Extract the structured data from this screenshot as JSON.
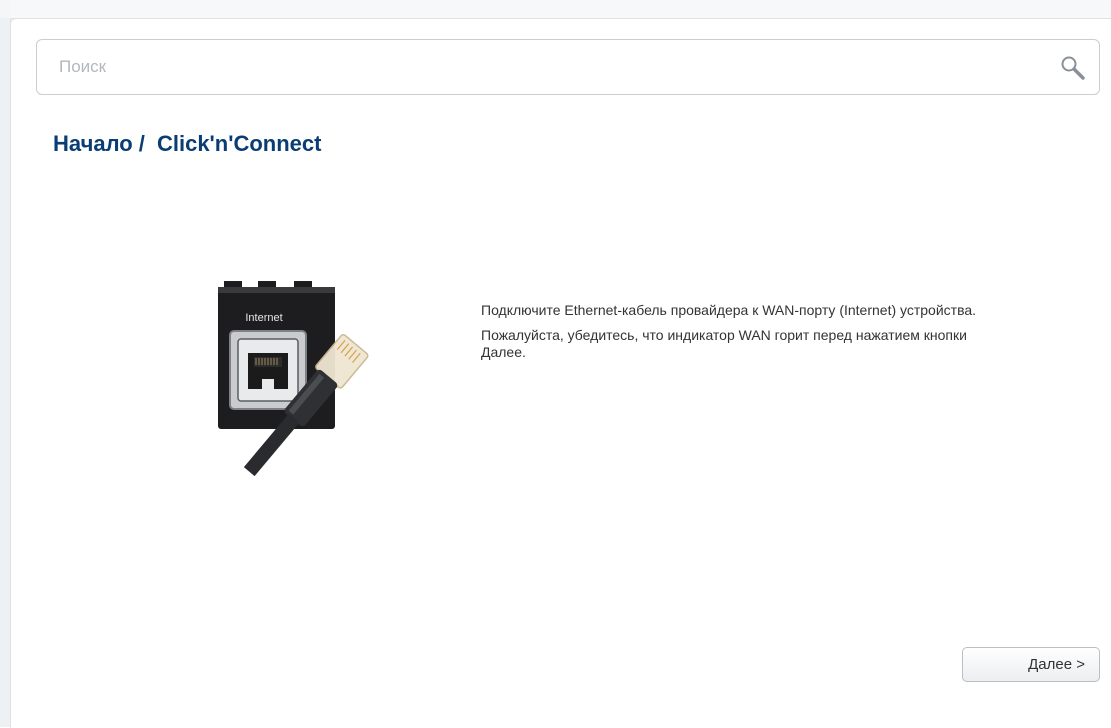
{
  "search": {
    "placeholder": "Поиск"
  },
  "breadcrumb": {
    "home": "Начало",
    "separator": "/",
    "current": "Click'n'Connect"
  },
  "illustration": {
    "port_label": "Internet"
  },
  "instructions": {
    "line1": "Подключите Ethernet-кабель провайдера к WAN-порту (Internet) устройства.",
    "line2": "Пожалуйста, убедитесь, что индикатор WAN горит перед нажатием кнопки Далее."
  },
  "buttons": {
    "next_label": "Далее >"
  },
  "colors": {
    "title": "#0a3d73",
    "text": "#333333",
    "border": "#c9ced3"
  }
}
